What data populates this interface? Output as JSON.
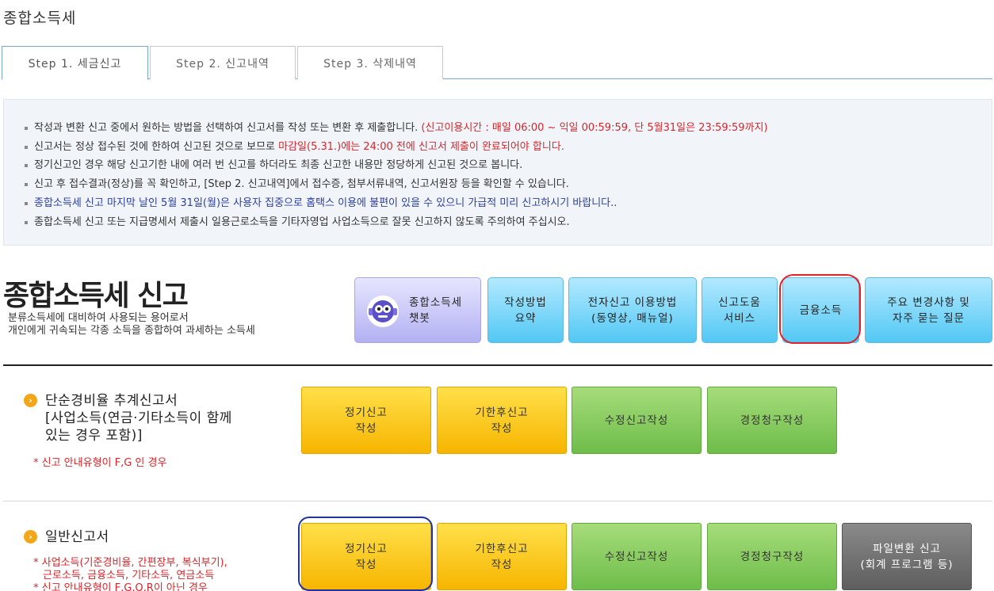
{
  "page": {
    "title": "종합소득세"
  },
  "tabs": [
    {
      "label": "Step 1. 세금신고",
      "active": true
    },
    {
      "label": "Step 2. 신고내역",
      "active": false
    },
    {
      "label": "Step 3. 삭제내역",
      "active": false
    }
  ],
  "notice": {
    "line1": "작성과 변환 신고 중에서 원하는 방법을 선택하여 신고서를 작성 또는 변환 후 제출합니다.",
    "line1_red": " (신고이용시간 : 매일 06:00 ~ 익일 00:59:59, 단 5월31일은 23:59:59까지)",
    "line2_a": "신고서는 정상 접수된 것에 한하여 신고된 것으로 보므로 ",
    "line2_red": "마감일(5.31.)에는 24:00 전에 신고서 제출이 완료되어야 합니다.",
    "line3": "정기신고인 경우 해당 신고기한 내에 여러 번 신고를 하더라도 최종 신고한 내용만 정당하게 신고된 것으로 봅니다.",
    "line4": "신고 후 접수결과(정상)를 꼭 확인하고, [Step 2. 신고내역]에서 접수증, 첨부서류내역, 신고서원장 등을 확인할 수 있습니다.",
    "line5": "종합소득세 신고 마지막 날인 5월 31일(월)은 사용자 집중으로 홈택스 이용에 불편이 있을 수 있으니 가급적 미리 신고하시기 바랍니다..",
    "line6": "종합소득세 신고 또는 지급명세서 제출시 일용근로소득을 기타자영업 사업소득으로 잘못 신고하지 않도록 주의하여 주십시오."
  },
  "main": {
    "title": "종합소득세 신고",
    "desc1": "분류소득세에 대비하여 사용되는 용어로서",
    "desc2": "개인에게 귀속되는 각종 소득을 종합하여 과세하는 소득세"
  },
  "top_buttons": {
    "chatbot_1": "종합소득세",
    "chatbot_2": "챗봇",
    "guide_1": "작성방법",
    "guide_2": "요약",
    "esubmit_1": "전자신고 이용방법",
    "esubmit_2": "(동영상, 매뉴얼)",
    "help_1": "신고도움",
    "help_2": "서비스",
    "finance": "금융소득",
    "faq_1": "주요 변경사항 및",
    "faq_2": "자주 묻는 질문"
  },
  "section_simple": {
    "title_1": "단순경비율 추계신고서",
    "title_2": "[사업소득(연금·기타소득이 함께",
    "title_3": "있는 경우 포함)]",
    "note": "* 신고 안내유형이 F,G 인 경우",
    "btn_regular_1": "정기신고",
    "btn_regular_2": "작성",
    "btn_late_1": "기한후신고",
    "btn_late_2": "작성",
    "btn_amend": "수정신고작성",
    "btn_claim": "경정청구작성"
  },
  "section_general": {
    "title": "일반신고서",
    "note_1": "* 사업소득(기준경비율, 간편장부, 복식부기),",
    "note_2": "근로소득, 금융소득, 기타소득, 연금소득",
    "note_3": "* 신고 안내유형이 F,G,Q,R이 아닌 경우",
    "btn_regular_1": "정기신고",
    "btn_regular_2": "작성",
    "btn_late_1": "기한후신고",
    "btn_late_2": "작성",
    "btn_amend": "수정신고작성",
    "btn_claim": "경정청구작성",
    "btn_file_1": "파일변환 신고",
    "btn_file_2": "(회계 프로그램 등)"
  }
}
